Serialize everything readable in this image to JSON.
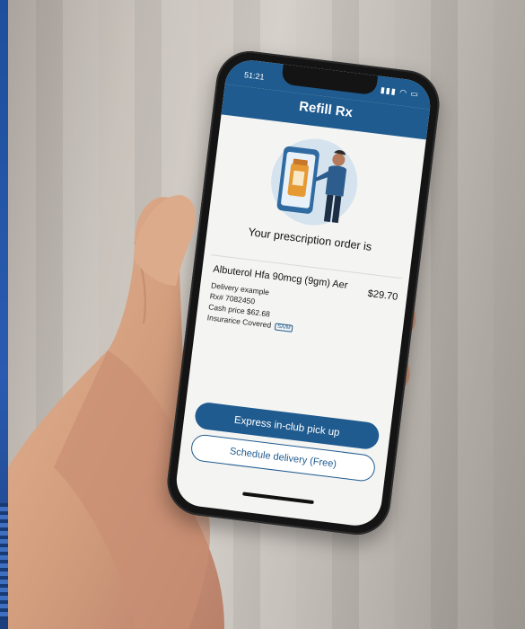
{
  "phone": {
    "status_time": "51:21",
    "status_icons": "▮▮▮ ◠ ▭",
    "header_title": "Refill Rx",
    "order_text": "Your prescription order is",
    "medication": {
      "name": "Albuterol Hfa 90mcg (9gm) Aer",
      "price": "$29.70",
      "delivery": "Delivery example",
      "rx_number": "Rx# 7082450",
      "cash_price": "Cash price $62.68",
      "insurance": "Insurarice Covered",
      "insurance_badge": "SA/M"
    },
    "buttons": {
      "primary": "Express in-club pick up",
      "secondary": "Schedule delivery (Free)"
    }
  },
  "colors": {
    "brand_blue": "#1f5b8f",
    "screen_bg": "#f4f4f2",
    "phone_body": "#141414"
  }
}
